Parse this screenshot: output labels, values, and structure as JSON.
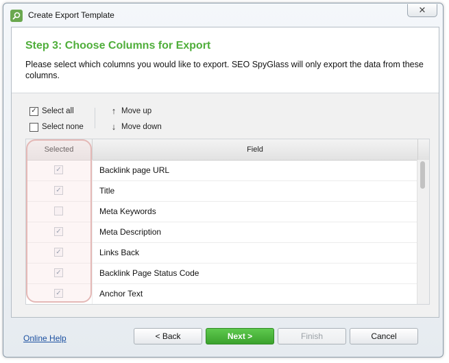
{
  "window": {
    "title": "Create Export Template",
    "close_label": "✕"
  },
  "header": {
    "step_title": "Step 3: Choose Columns for Export",
    "description": "Please select which columns you would like to export. SEO SpyGlass will only export the data from these columns."
  },
  "toolbar": {
    "select_all": "Select all",
    "select_none": "Select none",
    "move_up": "Move up",
    "move_down": "Move down"
  },
  "grid": {
    "columns": [
      "Selected",
      "Field"
    ],
    "rows": [
      {
        "field": "Backlink page URL",
        "checked": "✓"
      },
      {
        "field": "Title",
        "checked": "✓"
      },
      {
        "field": "Meta Keywords",
        "checked": ""
      },
      {
        "field": "Meta Description",
        "checked": "✓"
      },
      {
        "field": "Links Back",
        "checked": "✓"
      },
      {
        "field": "Backlink Page Status Code",
        "checked": "✓"
      },
      {
        "field": "Anchor Text",
        "checked": "✓"
      }
    ]
  },
  "footer": {
    "help": "Online Help",
    "back": "< Back",
    "next": "Next >",
    "finish": "Finish",
    "cancel": "Cancel"
  },
  "icons": {
    "checkbox_checked": "✓",
    "arrow_up": "↑",
    "arrow_down": "↓",
    "app": "🔍"
  },
  "colors": {
    "accent": "#4fae3a",
    "next_button": "#3ba22d",
    "highlight": "#e4b8b6"
  }
}
